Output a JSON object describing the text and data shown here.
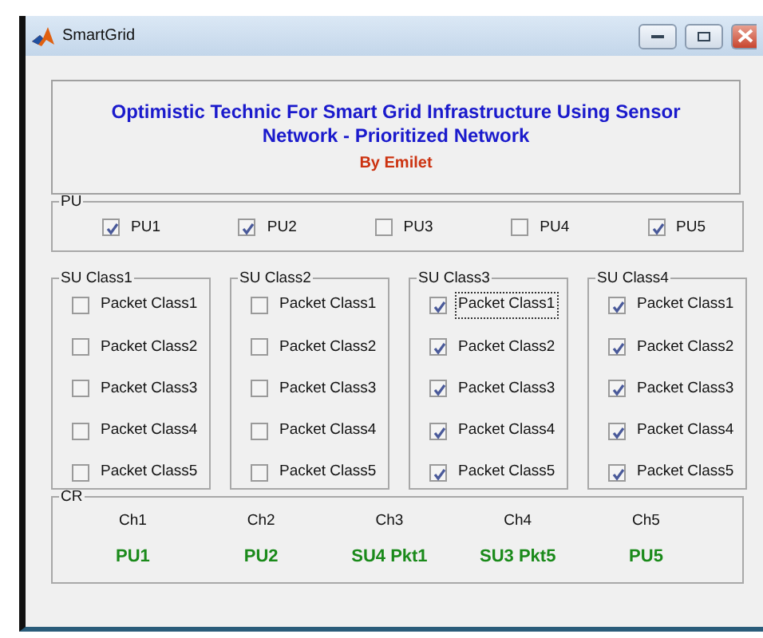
{
  "window": {
    "title": "SmartGrid"
  },
  "header": {
    "title": "Optimistic Technic For Smart Grid Infrastructure Using Sensor Network - Prioritized Network",
    "author": "By Emilet"
  },
  "pu": {
    "label": "PU",
    "items": [
      {
        "label": "PU1",
        "checked": true
      },
      {
        "label": "PU2",
        "checked": true
      },
      {
        "label": "PU3",
        "checked": false
      },
      {
        "label": "PU4",
        "checked": false
      },
      {
        "label": "PU5",
        "checked": true
      }
    ]
  },
  "su_classes": [
    {
      "label": "SU Class1",
      "items": [
        {
          "label": "Packet Class1",
          "checked": false,
          "focused": false
        },
        {
          "label": "Packet Class2",
          "checked": false,
          "focused": false
        },
        {
          "label": "Packet Class3",
          "checked": false,
          "focused": false
        },
        {
          "label": "Packet Class4",
          "checked": false,
          "focused": false
        },
        {
          "label": "Packet Class5",
          "checked": false,
          "focused": false
        }
      ]
    },
    {
      "label": "SU Class2",
      "items": [
        {
          "label": "Packet Class1",
          "checked": false,
          "focused": false
        },
        {
          "label": "Packet Class2",
          "checked": false,
          "focused": false
        },
        {
          "label": "Packet Class3",
          "checked": false,
          "focused": false
        },
        {
          "label": "Packet Class4",
          "checked": false,
          "focused": false
        },
        {
          "label": "Packet Class5",
          "checked": false,
          "focused": false
        }
      ]
    },
    {
      "label": "SU Class3",
      "items": [
        {
          "label": "Packet Class1",
          "checked": true,
          "focused": true
        },
        {
          "label": "Packet Class2",
          "checked": true,
          "focused": false
        },
        {
          "label": "Packet Class3",
          "checked": true,
          "focused": false
        },
        {
          "label": "Packet Class4",
          "checked": true,
          "focused": false
        },
        {
          "label": "Packet Class5",
          "checked": true,
          "focused": false
        }
      ]
    },
    {
      "label": "SU Class4",
      "items": [
        {
          "label": "Packet Class1",
          "checked": true,
          "focused": false
        },
        {
          "label": "Packet Class2",
          "checked": true,
          "focused": false
        },
        {
          "label": "Packet Class3",
          "checked": true,
          "focused": false
        },
        {
          "label": "Packet Class4",
          "checked": true,
          "focused": false
        },
        {
          "label": "Packet Class5",
          "checked": true,
          "focused": false
        }
      ]
    }
  ],
  "cr": {
    "label": "CR",
    "channels": [
      {
        "name": "Ch1",
        "value": "PU1"
      },
      {
        "name": "Ch2",
        "value": "PU2"
      },
      {
        "name": "Ch3",
        "value": "SU4 Pkt1"
      },
      {
        "name": "Ch4",
        "value": "SU3 Pkt5"
      },
      {
        "name": "Ch5",
        "value": "PU5"
      }
    ]
  }
}
